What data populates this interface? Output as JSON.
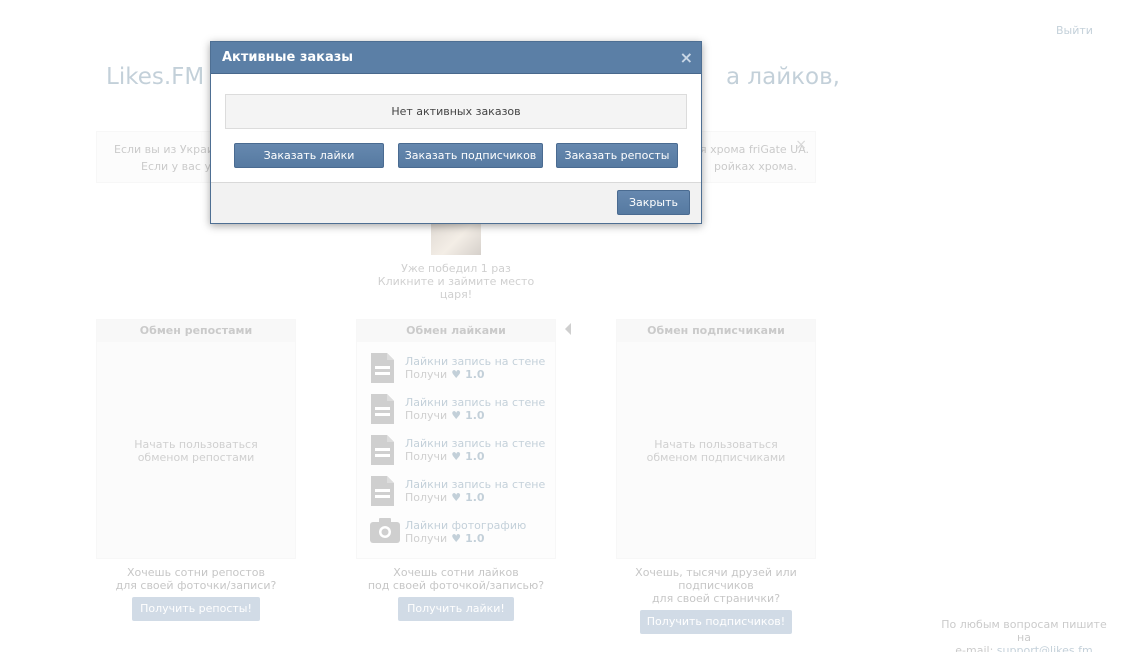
{
  "header": {
    "logout": "Выйти"
  },
  "headline": {
    "left": "Likes.FM –",
    "right": "а лайков,"
  },
  "notice": {
    "left_line1": "Если вы из Украин",
    "left_line2": "Если у вас уж",
    "right_line1": "я хрома friGate UA.",
    "right_line2": "ройках хрома.",
    "close": "×"
  },
  "winner": {
    "text": "Уже победил 1 раз\nКликните и займите место царя!"
  },
  "panels": {
    "reposts": {
      "title": "Обмен репостами",
      "body": "Начать пользоваться обменом репостами"
    },
    "likes": {
      "title": "Обмен лайками"
    },
    "subscribers": {
      "title": "Обмен подписчиками",
      "body": "Начать пользоваться обменом подписчиками"
    }
  },
  "tasks": [
    {
      "icon": "document-icon",
      "label": "Лайкни запись на стене",
      "reward_prefix": "Получи",
      "reward": "1.0"
    },
    {
      "icon": "document-icon",
      "label": "Лайкни запись на стене",
      "reward_prefix": "Получи",
      "reward": "1.0"
    },
    {
      "icon": "document-icon",
      "label": "Лайкни запись на стене",
      "reward_prefix": "Получи",
      "reward": "1.0"
    },
    {
      "icon": "document-icon",
      "label": "Лайкни запись на стене",
      "reward_prefix": "Получи",
      "reward": "1.0"
    },
    {
      "icon": "camera-icon",
      "label": "Лайкни фотографию",
      "reward_prefix": "Получи",
      "reward": "1.0"
    }
  ],
  "cta": {
    "reposts": {
      "text": "Хочешь сотни репостов для своей фоточки/записи?",
      "button": "Получить репосты!"
    },
    "likes": {
      "text": "Хочешь сотни лайков под своей фоточкой/записью?",
      "button": "Получить лайки!"
    },
    "subscribers": {
      "text": "Хочешь, тысячи друзей или подписчиков для своей странички?",
      "button": "Получить подписчиков!"
    }
  },
  "footer": {
    "text": "По любым вопросам пишите на e-mail: support@likes.fm"
  },
  "modal": {
    "title": "Активные заказы",
    "close_icon": "×",
    "empty_text": "Нет активных заказов",
    "buttons": {
      "order_likes": "Заказать лайки",
      "order_subscribers": "Заказать подписчиков",
      "order_reposts": "Заказать репосты"
    },
    "close_button": "Закрыть"
  },
  "colors": {
    "accent": "#5b7fa6",
    "link": "#2b587a"
  }
}
